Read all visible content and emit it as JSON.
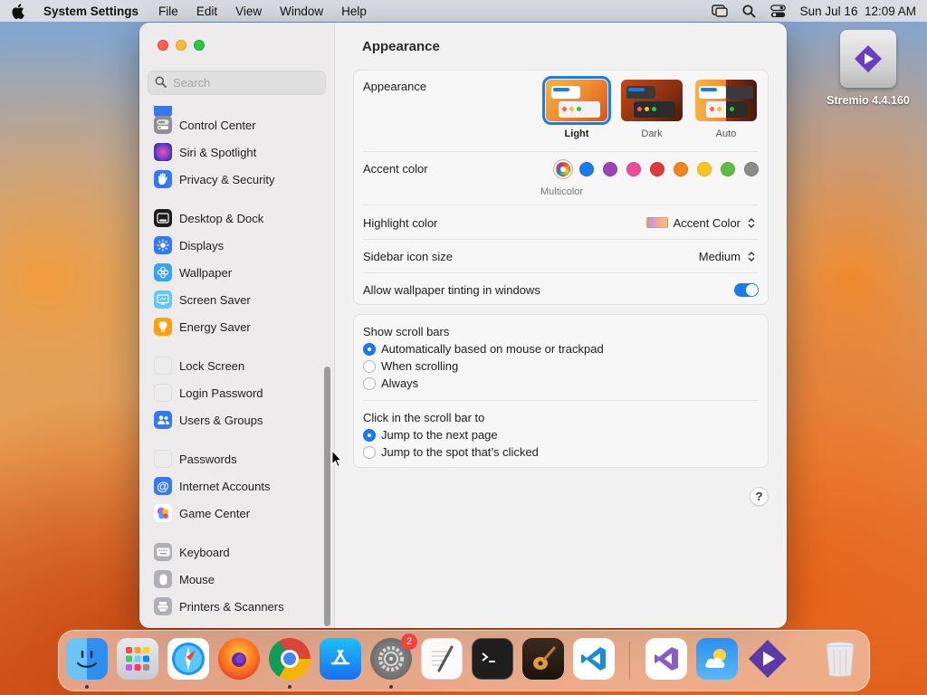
{
  "menubar": {
    "app_name": "System Settings",
    "menus": [
      "File",
      "Edit",
      "View",
      "Window",
      "Help"
    ],
    "datetime": "Sun Jul 16  12:09 AM"
  },
  "window": {
    "title": "Appearance",
    "search": {
      "placeholder": "Search"
    },
    "sidebar": {
      "items": [
        {
          "label": "Control Center",
          "icon": "control-center-icon",
          "color": "#8e8e93"
        },
        {
          "label": "Siri & Spotlight",
          "icon": "siri-icon",
          "color": "#6b3fd6"
        },
        {
          "label": "Privacy & Security",
          "icon": "hand-icon",
          "color": "#3478f6"
        },
        {
          "label": "Desktop & Dock",
          "icon": "dock-icon",
          "color": "#1c1c1e"
        },
        {
          "label": "Displays",
          "icon": "sun-icon",
          "color": "#3478f6"
        },
        {
          "label": "Wallpaper",
          "icon": "flower-icon",
          "color": "#35a4f4"
        },
        {
          "label": "Screen Saver",
          "icon": "screen-saver-icon",
          "color": "#5ac8fa"
        },
        {
          "label": "Energy Saver",
          "icon": "bulb-icon",
          "color": "#ff9f0a"
        },
        {
          "label": "Lock Screen",
          "icon": "lock-screen-icon",
          "color": "#e9e9e9"
        },
        {
          "label": "Login Password",
          "icon": "login-password-icon",
          "color": "#e9e9e9"
        },
        {
          "label": "Users & Groups",
          "icon": "users-icon",
          "color": "#3478f6"
        },
        {
          "label": "Passwords",
          "icon": "passwords-icon",
          "color": "#e9e9e9"
        },
        {
          "label": "Internet Accounts",
          "icon": "at-icon",
          "color": "#3478f6"
        },
        {
          "label": "Game Center",
          "icon": "game-center-icon",
          "color": "#ffffff"
        },
        {
          "label": "Keyboard",
          "icon": "keyboard-icon",
          "color": "#8e8e93"
        },
        {
          "label": "Mouse",
          "icon": "mouse-icon",
          "color": "#8e8e93"
        },
        {
          "label": "Printers & Scanners",
          "icon": "printer-icon",
          "color": "#8e8e93"
        }
      ]
    },
    "appearance": {
      "label": "Appearance",
      "options": [
        {
          "label": "Light",
          "selected": true
        },
        {
          "label": "Dark",
          "selected": false
        },
        {
          "label": "Auto",
          "selected": false
        }
      ]
    },
    "accent": {
      "label": "Accent color",
      "colors": [
        "multicolor",
        "#1a7bf0",
        "#9b44b6",
        "#ef4d99",
        "#e0383e",
        "#f7821b",
        "#fec41b",
        "#62ba46",
        "#8c8c8c"
      ],
      "selected_caption": "Multicolor"
    },
    "highlight": {
      "label": "Highlight color",
      "value": "Accent Color"
    },
    "sidebar_icon_size": {
      "label": "Sidebar icon size",
      "value": "Medium"
    },
    "wallpaper_tinting": {
      "label": "Allow wallpaper tinting in windows",
      "enabled": true
    },
    "scroll_bars": {
      "label": "Show scroll bars",
      "options": [
        {
          "label": "Automatically based on mouse or trackpad",
          "selected": true
        },
        {
          "label": "When scrolling",
          "selected": false
        },
        {
          "label": "Always",
          "selected": false
        }
      ]
    },
    "click_scroll": {
      "label": "Click in the scroll bar to",
      "options": [
        {
          "label": "Jump to the next page",
          "selected": true
        },
        {
          "label": "Jump to the spot that’s clicked",
          "selected": false
        }
      ]
    },
    "help_label": "?"
  },
  "desktop": {
    "icon_label": "Stremio 4.4.160"
  },
  "dock": {
    "apps": [
      "Finder",
      "Launchpad",
      "Safari",
      "Firefox",
      "Chrome",
      "App Store",
      "System Settings",
      "TextEdit",
      "Terminal",
      "GarageBand",
      "Visual Studio Code",
      "Visual Studio",
      "Weather",
      "Stremio",
      "Trash"
    ],
    "settings_badge": "2"
  }
}
